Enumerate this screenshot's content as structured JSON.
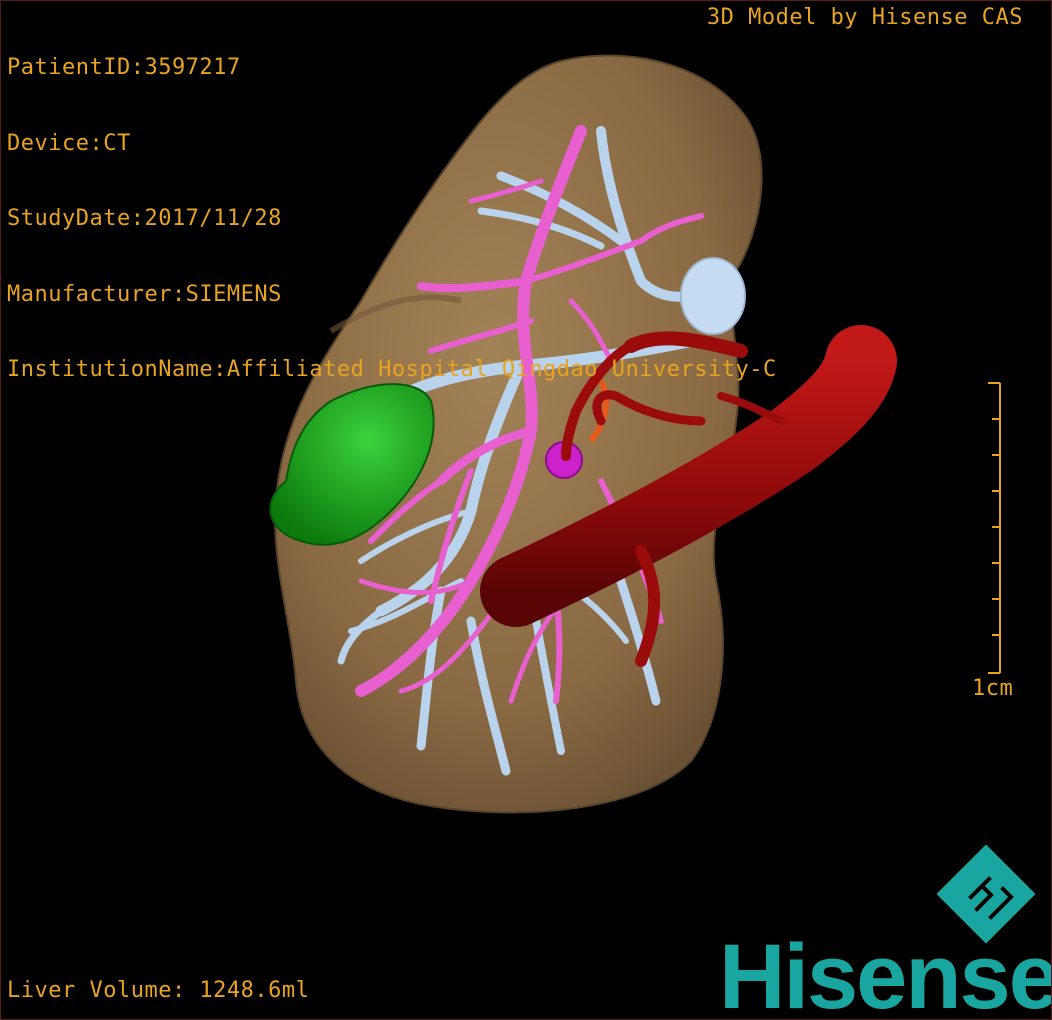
{
  "header_info": {
    "patient_id": "PatientID:3597217",
    "device": "Device:CT",
    "study_date": "StudyDate:2017/11/28",
    "manufacturer": "Manufacturer:SIEMENS",
    "institution": "InstitutionName:Affiliated Hospital Qingdao University-C"
  },
  "model_credit": "3D Model by Hisense CAS",
  "liver_volume": "Liver Volume: 1248.6ml",
  "scale_bar": {
    "label": "1cm",
    "color": "#e8a321"
  },
  "brand": {
    "name": "Hisense",
    "color": "#1aa6a0"
  },
  "colors": {
    "overlay_text": "#e8a321",
    "liver": "#8c6b45",
    "portal_vein": "#e85fd0",
    "hepatic_vein": "#b9d3ec",
    "ivc_artery": "#a00c0c",
    "tumor": "#1fa01f",
    "lesion": "#cc22cc"
  }
}
